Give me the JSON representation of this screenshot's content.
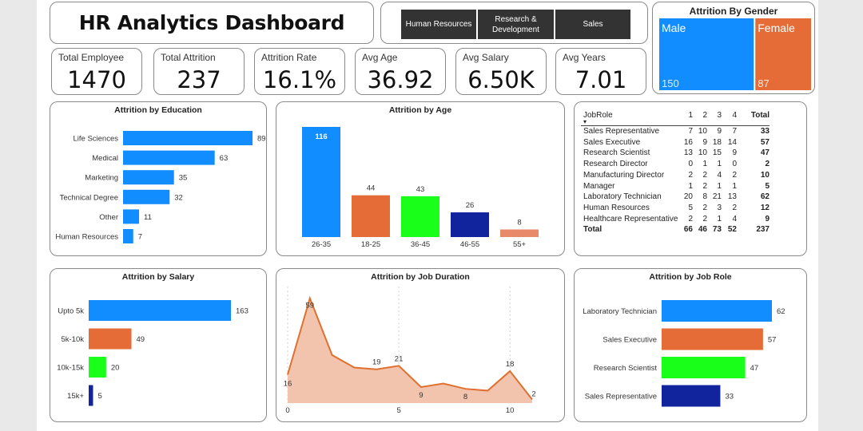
{
  "dashboard": {
    "title": "HR Analytics Dashboard"
  },
  "slicer": {
    "buttons": [
      "Human Resources",
      "Research & Development",
      "Sales"
    ]
  },
  "kpis": [
    {
      "label": "Total Employee",
      "value": "1470"
    },
    {
      "label": "Total Attrition",
      "value": "237"
    },
    {
      "label": "Attrition Rate",
      "value": "16.1%"
    },
    {
      "label": "Avg Age",
      "value": "36.92"
    },
    {
      "label": "Avg Salary",
      "value": "6.50K"
    },
    {
      "label": "Avg Years",
      "value": "7.01"
    }
  ],
  "colors": {
    "blue": "#118dff",
    "orange": "#e66c37",
    "green": "#1aff1a",
    "navy": "#12239e",
    "peach": "#e8896a",
    "area_fill": "#f2c4ad",
    "area_line": "#e0702f"
  },
  "chart_data": [
    {
      "id": "gender",
      "type": "treemap",
      "title": "Attrition By Gender",
      "categories": [
        "Male",
        "Female"
      ],
      "values": [
        150,
        87
      ]
    },
    {
      "id": "education",
      "type": "bar",
      "orientation": "horizontal",
      "title": "Attrition by Education",
      "categories": [
        "Life Sciences",
        "Medical",
        "Marketing",
        "Technical Degree",
        "Other",
        "Human Resources"
      ],
      "values": [
        89,
        63,
        35,
        32,
        11,
        7
      ]
    },
    {
      "id": "age",
      "type": "bar",
      "orientation": "vertical",
      "title": "Attrition by Age",
      "categories": [
        "26-35",
        "18-25",
        "36-45",
        "46-55",
        "55+"
      ],
      "values": [
        116,
        44,
        43,
        26,
        8
      ]
    },
    {
      "id": "salary",
      "type": "bar",
      "orientation": "horizontal",
      "title": "Attrition by Salary",
      "categories": [
        "Upto 5k",
        "5k-10k",
        "10k-15k",
        "15k+"
      ],
      "values": [
        163,
        49,
        20,
        5
      ]
    },
    {
      "id": "duration",
      "type": "area",
      "title": "Attrition by Job Duration",
      "x": [
        0,
        1,
        2,
        3,
        4,
        5,
        6,
        7,
        8,
        9,
        10,
        11
      ],
      "y": [
        16,
        59,
        27,
        20,
        19,
        21,
        9,
        11,
        8,
        7,
        18,
        2
      ],
      "point_labels": [
        "16",
        "59",
        "",
        "",
        "19",
        "21",
        "9",
        "",
        "8",
        "",
        "18",
        "2"
      ],
      "xticks": [
        0,
        5,
        10
      ],
      "ylim": [
        0,
        62
      ]
    },
    {
      "id": "jobrole",
      "type": "bar",
      "orientation": "horizontal",
      "title": "Attrition by Job Role",
      "categories": [
        "Laboratory Technician",
        "Sales Executive",
        "Research Scientist",
        "Sales Representative"
      ],
      "values": [
        62,
        57,
        47,
        33
      ]
    },
    {
      "id": "matrix",
      "type": "table",
      "columns": [
        "JobRole",
        "1",
        "2",
        "3",
        "4",
        "Total"
      ],
      "rows": [
        [
          "Sales Representative",
          "7",
          "10",
          "9",
          "7",
          "33"
        ],
        [
          "Sales Executive",
          "16",
          "9",
          "18",
          "14",
          "57"
        ],
        [
          "Research Scientist",
          "13",
          "10",
          "15",
          "9",
          "47"
        ],
        [
          "Research Director",
          "0",
          "1",
          "1",
          "0",
          "2"
        ],
        [
          "Manufacturing Director",
          "2",
          "2",
          "4",
          "2",
          "10"
        ],
        [
          "Manager",
          "1",
          "2",
          "1",
          "1",
          "5"
        ],
        [
          "Laboratory Technician",
          "20",
          "8",
          "21",
          "13",
          "62"
        ],
        [
          "Human Resources",
          "5",
          "2",
          "3",
          "2",
          "12"
        ],
        [
          "Healthcare Representative",
          "2",
          "2",
          "1",
          "4",
          "9"
        ]
      ],
      "total_row": [
        "Total",
        "66",
        "46",
        "73",
        "52",
        "237"
      ]
    }
  ]
}
